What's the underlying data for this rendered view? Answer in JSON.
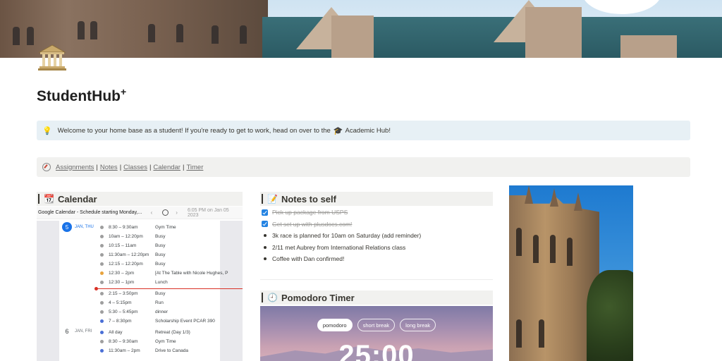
{
  "page": {
    "title": "StudentHub",
    "title_sup": "+",
    "callout_text": "Welcome to your home base as a student! If you're ready to get to work, head on over to the",
    "callout_link": "Academic Hub",
    "callout_end": "!"
  },
  "nav": {
    "links": [
      "Assignments",
      "Notes",
      "Classes",
      "Calendar",
      "Timer"
    ],
    "separator": "|"
  },
  "calendar": {
    "heading": "Calendar",
    "embed_title": "Google Calendar - Schedule starting Monday,...",
    "timestamp": "6:05 PM on Jan 05 2023",
    "days": [
      {
        "num": "5",
        "label": "JAN, THU"
      },
      {
        "num": "6",
        "label": "JAN, FRI"
      }
    ],
    "events": [
      {
        "time": "8:30 – 9:30am",
        "title": "Gym Time",
        "color": "#9e9e9e"
      },
      {
        "time": "10am – 12:20pm",
        "title": "Busy",
        "color": "#9e9e9e"
      },
      {
        "time": "10:15 – 11am",
        "title": "Busy",
        "color": "#9e9e9e"
      },
      {
        "time": "11:30am – 12:20pm",
        "title": "Busy",
        "color": "#9e9e9e"
      },
      {
        "time": "12:15 – 12:20pm",
        "title": "Busy",
        "color": "#9e9e9e"
      },
      {
        "time": "12:30 – 2pm",
        "title": "[At The Table with Nicole Hughes, P",
        "color": "#e8a33d"
      },
      {
        "time": "12:30 – 1pm",
        "title": "Lunch",
        "color": "#9e9e9e"
      },
      {
        "time": "2:15 – 3:50pm",
        "title": "Busy",
        "color": "#9e9e9e"
      },
      {
        "time": "4 – 5:15pm",
        "title": "Run",
        "color": "#9e9e9e"
      },
      {
        "time": "5:30 – 5:45pm",
        "title": "dinner",
        "color": "#9e9e9e"
      },
      {
        "time": "7 – 8:30pm",
        "title": "Scholarship Event  PCAR 390",
        "color": "#4a6fd6"
      },
      {
        "time": "All day",
        "title": "Retreat (Day 1/3)",
        "color": "#4a6fd6"
      },
      {
        "time": "8:30 – 9:30am",
        "title": "Gym Time",
        "color": "#9e9e9e"
      },
      {
        "time": "11:30am – 2pm",
        "title": "Drive to Canada",
        "color": "#4a6fd6"
      }
    ]
  },
  "notes": {
    "heading": "Notes to self",
    "checked": [
      {
        "pre": "Pick up package from USPS",
        "link": ""
      },
      {
        "pre": "Get set up with ",
        "link": "plusdocs.com!"
      }
    ],
    "bullets": [
      "3k race is planned for 10am on Saturday (add reminder)",
      "2/11 met Aubrey from International Relations class",
      "Coffee with Dan confirmed!"
    ]
  },
  "pomodoro": {
    "heading": "Pomodoro Timer",
    "modes": [
      "pomodoro",
      "short break",
      "long break"
    ],
    "active_mode": "pomodoro",
    "time": "25:00"
  },
  "icons": {
    "page": "classical-building-icon",
    "callout": "lightbulb-icon",
    "academic": "graduation-cap-icon",
    "nav": "compass-icon",
    "calendar": "calendar-icon",
    "notes": "memo-icon",
    "pomodoro": "clock-icon"
  },
  "colors": {
    "callout_bg": "#e7f0f5",
    "nav_bg": "#f1f1ef",
    "checkbox": "#2383e2",
    "today": "#1a73e8",
    "now_line": "#d93025"
  }
}
